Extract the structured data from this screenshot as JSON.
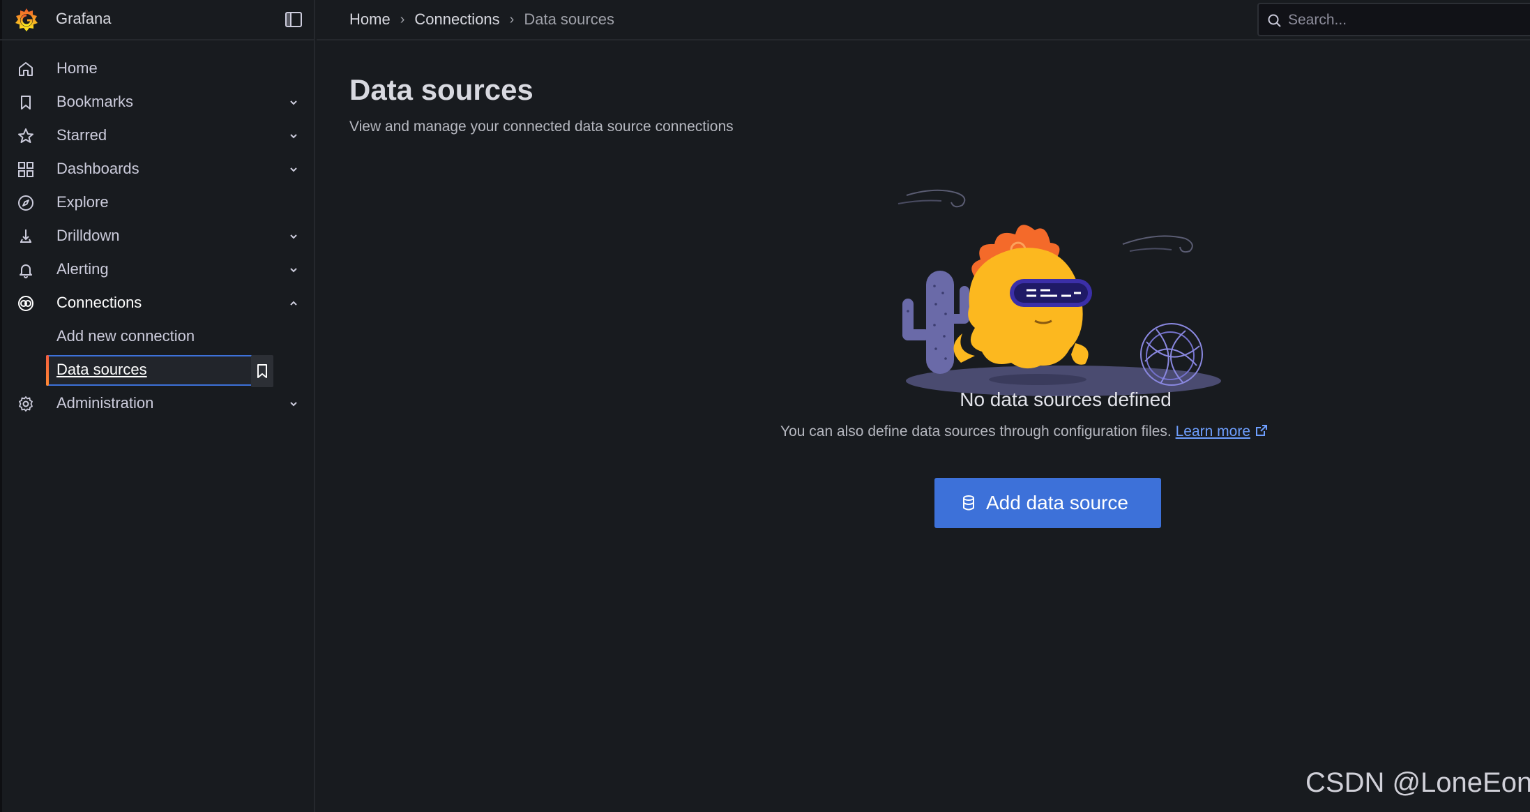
{
  "app": {
    "name": "Grafana"
  },
  "colors": {
    "accent": "#3d71d9",
    "brand_orange": "#f46800",
    "background": "#181b1f",
    "link": "#6e9fff"
  },
  "sidebar": {
    "items": [
      {
        "label": "Home",
        "icon": "home-icon",
        "expandable": false
      },
      {
        "label": "Bookmarks",
        "icon": "bookmark-icon",
        "expandable": true
      },
      {
        "label": "Starred",
        "icon": "star-icon",
        "expandable": true
      },
      {
        "label": "Dashboards",
        "icon": "apps-icon",
        "expandable": true
      },
      {
        "label": "Explore",
        "icon": "compass-icon",
        "expandable": false
      },
      {
        "label": "Drilldown",
        "icon": "drilldown-icon",
        "expandable": true
      },
      {
        "label": "Alerting",
        "icon": "bell-icon",
        "expandable": true
      },
      {
        "label": "Connections",
        "icon": "connections-icon",
        "expandable": true,
        "expanded": true,
        "children": [
          {
            "label": "Add new connection"
          },
          {
            "label": "Data sources",
            "current": true
          }
        ]
      },
      {
        "label": "Administration",
        "icon": "cog-icon",
        "expandable": true
      }
    ]
  },
  "breadcrumb": [
    "Home",
    "Connections",
    "Data sources"
  ],
  "search": {
    "placeholder": "Search..."
  },
  "page": {
    "title": "Data sources",
    "subtitle": "View and manage your connected data source connections"
  },
  "empty_state": {
    "title": "No data sources defined",
    "description": "You can also define data sources through configuration files.",
    "link": "Learn more",
    "button": "Add data source"
  },
  "watermark": "CSDN @LoneEon"
}
